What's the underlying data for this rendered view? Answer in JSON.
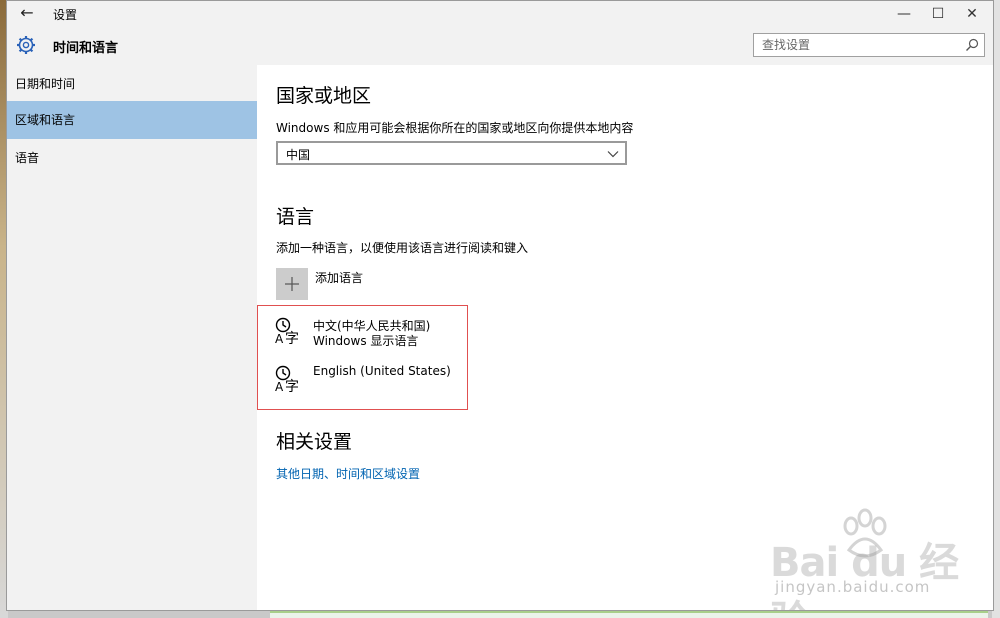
{
  "window": {
    "title": "设置"
  },
  "header": {
    "title": "时间和语言",
    "search_placeholder": "查找设置"
  },
  "sidebar": {
    "items": [
      {
        "label": "日期和时间",
        "selected": false
      },
      {
        "label": "区域和语言",
        "selected": true
      },
      {
        "label": "语音",
        "selected": false
      }
    ]
  },
  "region": {
    "heading": "国家或地区",
    "description": "Windows 和应用可能会根据你所在的国家或地区向你提供本地内容",
    "selected_country": "中国"
  },
  "language": {
    "heading": "语言",
    "description": "添加一种语言，以便使用该语言进行阅读和键入",
    "add_label": "添加语言",
    "items": [
      {
        "name": "中文(中华人民共和国)",
        "subtitle": "Windows 显示语言"
      },
      {
        "name": "English (United States)",
        "subtitle": ""
      }
    ]
  },
  "related": {
    "heading": "相关设置",
    "link": "其他日期、时间和区域设置"
  },
  "watermark": {
    "brand": "Bai du 经验",
    "url": "jingyan.baidu.com"
  },
  "colors": {
    "accent": "#0063b1",
    "selected_sidebar": "#9ec3e4",
    "highlight_border": "#e05050"
  }
}
